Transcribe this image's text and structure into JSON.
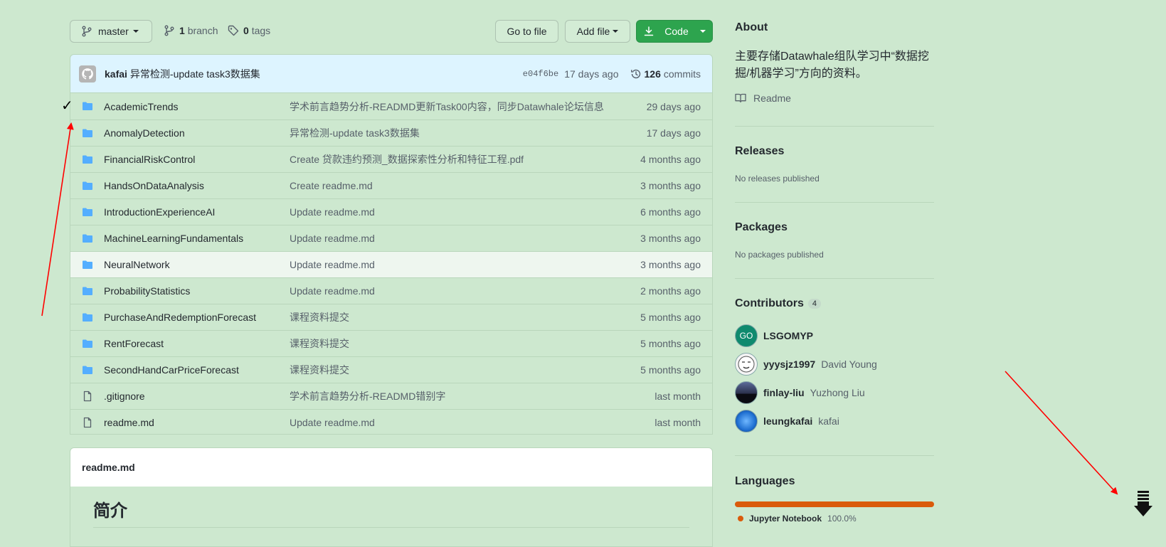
{
  "toolbar": {
    "branch": "master",
    "branch_count": "1",
    "branch_label": "branch",
    "tag_count": "0",
    "tag_label": "tags",
    "go_to_file": "Go to file",
    "add_file": "Add file",
    "code": "Code"
  },
  "commit": {
    "author": "kafai",
    "message": "异常检测-update task3数据集",
    "sha": "e04f6be",
    "age": "17 days ago",
    "count": "126",
    "count_label": "commits"
  },
  "files": [
    {
      "type": "folder",
      "name": "AcademicTrends",
      "message": "学术前言趋势分析-READMD更新Task00内容，同步Datawhale论坛信息",
      "age": "29 days ago"
    },
    {
      "type": "folder",
      "name": "AnomalyDetection",
      "message": "异常检测-update task3数据集",
      "age": "17 days ago"
    },
    {
      "type": "folder",
      "name": "FinancialRiskControl",
      "message": "Create 贷款违约预测_数据探索性分析和特征工程.pdf",
      "age": "4 months ago"
    },
    {
      "type": "folder",
      "name": "HandsOnDataAnalysis",
      "message": "Create readme.md",
      "age": "3 months ago"
    },
    {
      "type": "folder",
      "name": "IntroductionExperienceAI",
      "message": "Update readme.md",
      "age": "6 months ago"
    },
    {
      "type": "folder",
      "name": "MachineLearningFundamentals",
      "message": "Update readme.md",
      "age": "3 months ago"
    },
    {
      "type": "folder",
      "name": "NeuralNetwork",
      "message": "Update readme.md",
      "age": "3 months ago"
    },
    {
      "type": "folder",
      "name": "ProbabilityStatistics",
      "message": "Update readme.md",
      "age": "2 months ago"
    },
    {
      "type": "folder",
      "name": "PurchaseAndRedemptionForecast",
      "message": "课程资料提交",
      "age": "5 months ago"
    },
    {
      "type": "folder",
      "name": "RentForecast",
      "message": "课程资料提交",
      "age": "5 months ago"
    },
    {
      "type": "folder",
      "name": "SecondHandCarPriceForecast",
      "message": "课程资料提交",
      "age": "5 months ago"
    },
    {
      "type": "file",
      "name": ".gitignore",
      "message": "学术前言趋势分析-READMD错别字",
      "age": "last month"
    },
    {
      "type": "file",
      "name": "readme.md",
      "message": "Update readme.md",
      "age": "last month"
    }
  ],
  "readme": {
    "filename": "readme.md",
    "heading": "简介"
  },
  "about": {
    "title": "About",
    "description": "主要存储Datawhale组队学习中“数据挖掘/机器学习”方向的资料。",
    "readme_link": "Readme"
  },
  "releases": {
    "title": "Releases",
    "empty": "No releases published"
  },
  "packages": {
    "title": "Packages",
    "empty": "No packages published"
  },
  "contributors": {
    "title": "Contributors",
    "count": "4",
    "items": [
      {
        "login": "LSGOMYP",
        "name": ""
      },
      {
        "login": "yyysjz1997",
        "name": "David Young"
      },
      {
        "login": "finlay-liu",
        "name": "Yuzhong Liu"
      },
      {
        "login": "leungkafai",
        "name": "kafai"
      }
    ]
  },
  "languages": {
    "title": "Languages",
    "items": [
      {
        "name": "Jupyter Notebook",
        "percent": "100.0%",
        "color": "#da5b0b"
      }
    ]
  },
  "annotations": {
    "checkmark": "✓",
    "arrow_color": "#ff0000"
  }
}
